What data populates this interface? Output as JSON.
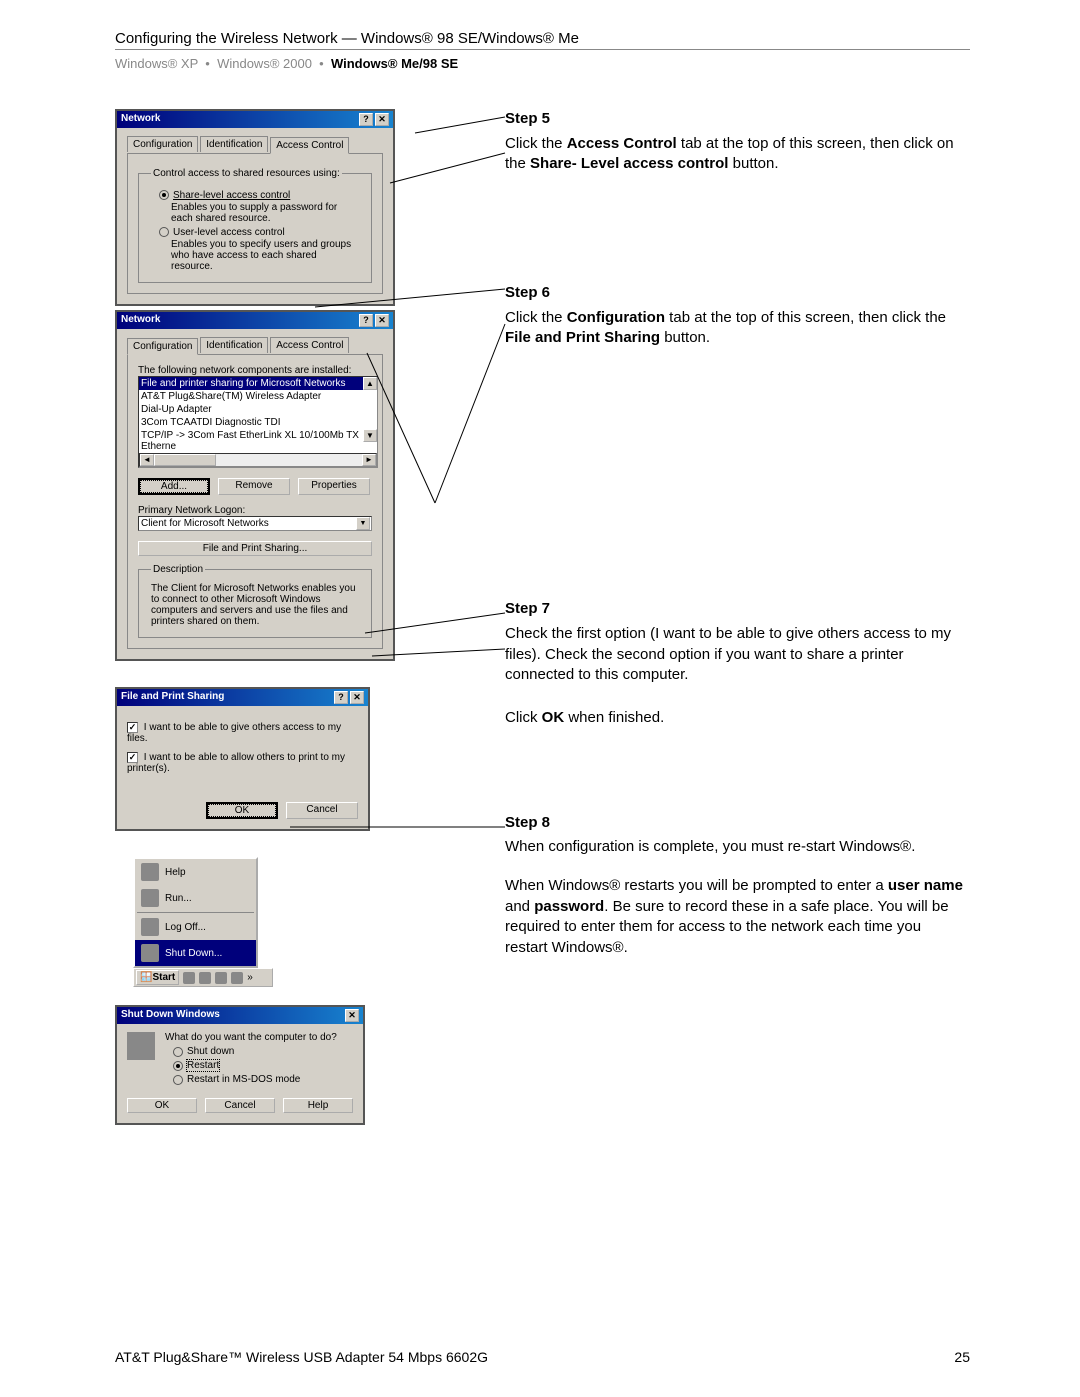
{
  "header": {
    "title": "Configuring the Wireless Network — Windows® 98 SE/Windows® Me",
    "breadcrumb": {
      "xp": "Windows® XP",
      "sep": "•",
      "k2": "Windows® 2000",
      "me": "Windows® Me/98 SE"
    }
  },
  "dlg1": {
    "title": "Network",
    "tabs": {
      "conf": "Configuration",
      "ident": "Identification",
      "acc": "Access Control"
    },
    "legend": "Control access to shared resources using:",
    "opt1": "Share-level access control",
    "opt1_desc": "Enables you to supply a password for each shared resource.",
    "opt2": "User-level access control",
    "opt2_desc": "Enables you to specify users and groups who have access to each shared resource."
  },
  "dlg2": {
    "title": "Network",
    "tabs": {
      "conf": "Configuration",
      "ident": "Identification",
      "acc": "Access Control"
    },
    "listlabel": "The following network components are installed:",
    "items": [
      "File and printer sharing for Microsoft Networks",
      "AT&T Plug&Share(TM) Wireless Adapter",
      "Dial-Up Adapter",
      "3Com TCAATDI Diagnostic TDI",
      "TCP/IP -> 3Com Fast EtherLink XL 10/100Mb TX Etherne"
    ],
    "add": "Add...",
    "remove": "Remove",
    "properties": "Properties",
    "primary_label": "Primary Network Logon:",
    "primary_value": "Client for Microsoft Networks",
    "fps": "File and Print Sharing...",
    "desc_legend": "Description",
    "desc_text": "The Client for Microsoft Networks enables you to connect to other Microsoft Windows computers and servers and use the files and printers shared on them."
  },
  "dlg3": {
    "title": "File and Print Sharing",
    "opt1": "I want to be able to give others access to my files.",
    "opt2": "I want to be able to allow others to print to my printer(s).",
    "ok": "OK",
    "cancel": "Cancel"
  },
  "startmenu": {
    "help": "Help",
    "run": "Run...",
    "logoff": "Log Off...",
    "shut": "Shut Down..."
  },
  "taskbar": {
    "start": "Start"
  },
  "dlg4": {
    "title": "Shut Down Windows",
    "prompt": "What do you want the computer to do?",
    "opt1": "Shut down",
    "opt2": "Restart",
    "opt3": "Restart in MS-DOS mode",
    "ok": "OK",
    "cancel": "Cancel",
    "help": "Help"
  },
  "right": {
    "step5_h": "Step 5",
    "step5_p1a": "Click the ",
    "step5_b1": "Access Control",
    "step5_p1b": " tab at the top of this screen, then click on the ",
    "step5_b2": "Share- Level access control",
    "step5_p1c": " button.",
    "step6_h": "Step 6",
    "step6_p1a": "Click the ",
    "step6_b1": "Configuration",
    "step6_p1b": " tab at the top of this screen, then click the ",
    "step6_b2": "File and Print Sharing",
    "step6_p1c": " button.",
    "step7_h": "Step 7",
    "step7_p": "Check the first option (I want to be able to give others access to my files). Check the second option if you want to share a printer connected to this computer.",
    "step7_p2a": "Click ",
    "step7_b1": "OK",
    "step7_p2b": " when finished.",
    "step8_h": "Step 8",
    "step8_p1": "When configuration is complete, you must re-start Windows®.",
    "step8_p2a": "When Windows® restarts you will be prompted to enter a ",
    "step8_b1": "user name",
    "step8_and": " and ",
    "step8_b2": "password",
    "step8_p2b": ". Be sure to record these in a safe place. You will be required to enter them for access to the network each time you restart Windows®."
  },
  "footer": {
    "left": "AT&T Plug&Share™ Wireless USB Adapter 54 Mbps 6602G",
    "right": "25"
  }
}
